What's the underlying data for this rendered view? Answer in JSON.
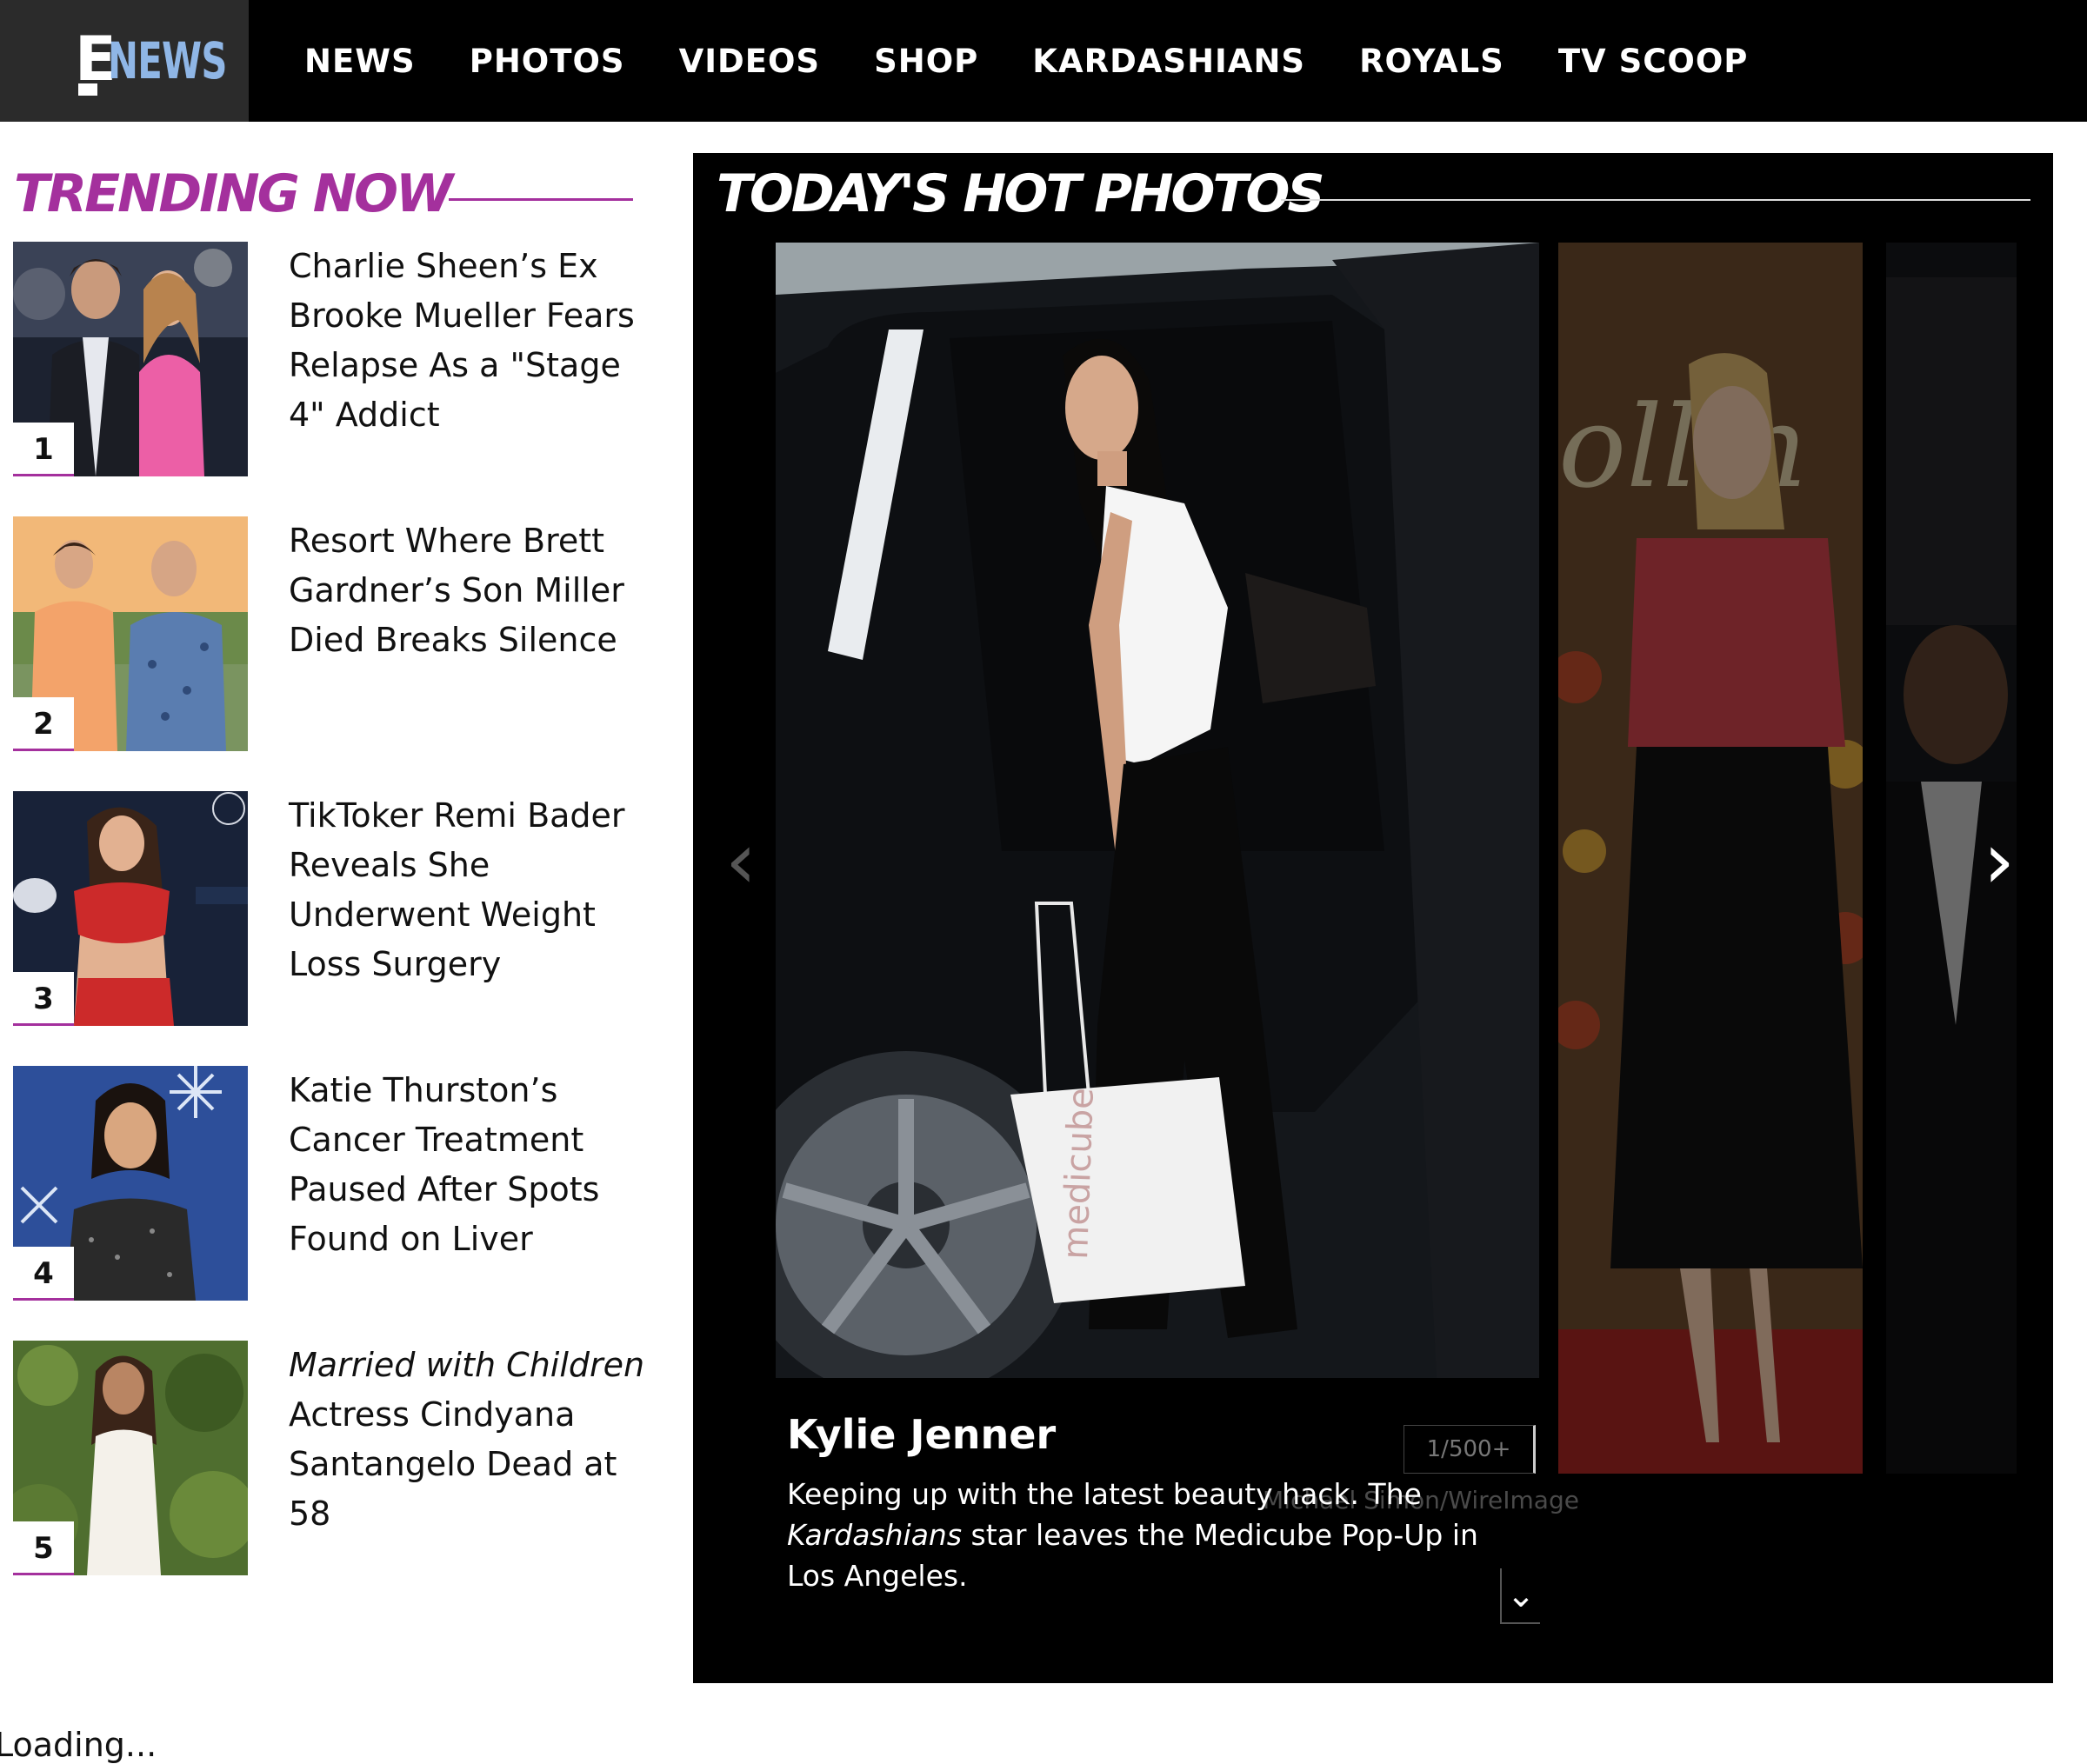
{
  "header": {
    "logo_letter": "E",
    "logo_word": "NEWS",
    "nav": [
      "NEWS",
      "PHOTOS",
      "VIDEOS",
      "SHOP",
      "KARDASHIANS",
      "ROYALS",
      "TV SCOOP"
    ]
  },
  "trending": {
    "heading": "TRENDING NOW",
    "accent_color": "#a4309d",
    "items": [
      {
        "rank": "1",
        "title": "Charlie Sheen’s Ex Brooke Mueller Fears Relapse As a \"Stage 4\" Addict"
      },
      {
        "rank": "2",
        "title": "Resort Where Brett Gardner’s Son Miller Died Breaks Silence"
      },
      {
        "rank": "3",
        "title": "TikToker Remi Bader Reveals She Underwent Weight Loss Surgery"
      },
      {
        "rank": "4",
        "title": "Katie Thurston’s Cancer Treatment Paused After Spots Found on Liver"
      },
      {
        "rank": "5",
        "title_italic": "Married with Children",
        "title": "Actress Cindyana Santangelo Dead at 58"
      }
    ]
  },
  "hot_photos": {
    "heading": "TODAY'S HOT PHOTOS",
    "caption": {
      "name": "Kylie Jenner",
      "counter": "1/500+",
      "credit": "Michael Simon/WireImage",
      "text_before": "Keeping up with the latest beauty hack. The",
      "text_italic": "Kardashians",
      "text_after": "star leaves the Medicube Pop-Up in Los Angeles."
    },
    "bag_brand": "medicube",
    "prev_icon": "chevron-left-icon",
    "next_icon": "chevron-right-icon",
    "expand_icon": "chevron-down-icon"
  },
  "footer": {
    "loading_text": "Loading..."
  }
}
